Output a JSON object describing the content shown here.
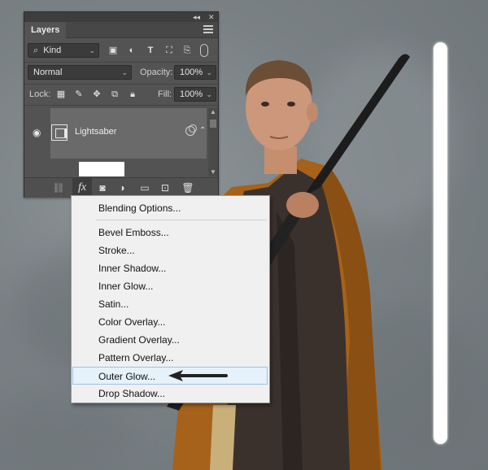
{
  "panel": {
    "tab_title": "Layers",
    "collapse_glyph": "◂◂",
    "close_glyph": "✕",
    "filter_kind": "Kind",
    "blend_mode": "Normal",
    "opacity_label": "Opacity:",
    "opacity_value": "100%",
    "lock_label": "Lock:",
    "fill_label": "Fill:",
    "fill_value": "100%",
    "layer_name": "Lightsaber",
    "fx_button": "fx"
  },
  "menu": {
    "items": [
      "Blending Options...",
      "Bevel  Emboss...",
      "Stroke...",
      "Inner Shadow...",
      "Inner Glow...",
      "Satin...",
      "Color Overlay...",
      "Gradient Overlay...",
      "Pattern Overlay...",
      "Outer Glow...",
      "Drop Shadow..."
    ],
    "highlighted": "Outer Glow..."
  },
  "colors": {
    "panel_bg": "#535353",
    "menu_bg": "#f0f0f0",
    "menu_highlight": "#e5f1fb",
    "cloak": "#b06a1c",
    "robe": "#3a302c"
  },
  "icons": {
    "search": "search-icon",
    "eye": "eye-icon",
    "link": "link-icon",
    "mask": "mask-icon",
    "adjustment": "adjustment-icon",
    "folder": "folder-icon",
    "new_layer": "new-layer-icon",
    "trash": "trash-icon"
  }
}
